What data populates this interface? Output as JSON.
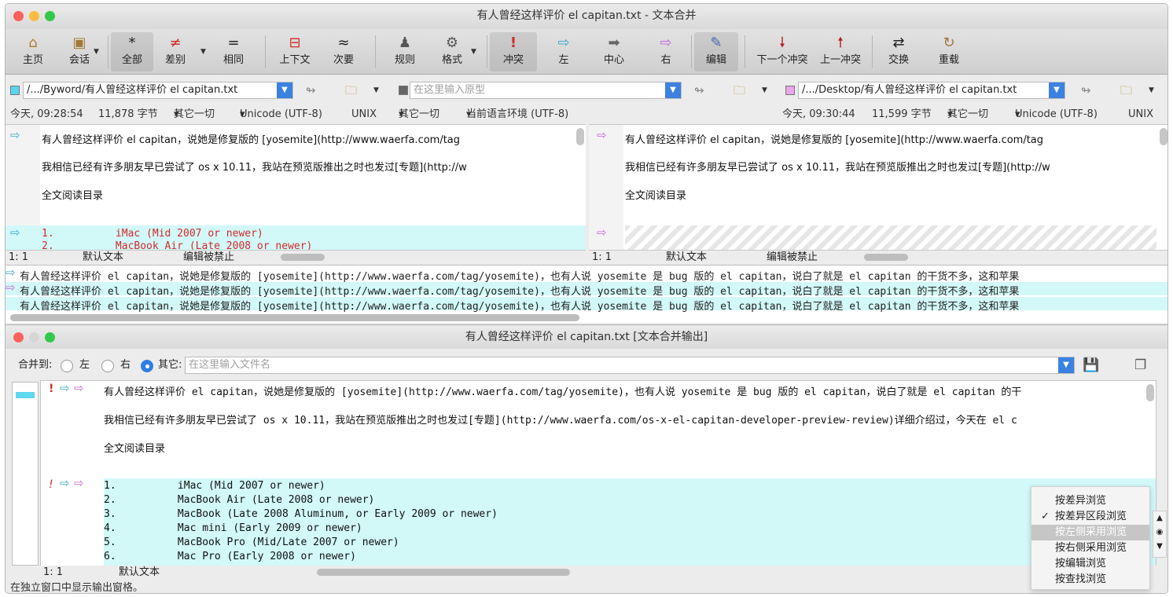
{
  "window": {
    "title": "有人曾经这样评价 el capitan.txt - 文本合并"
  },
  "toolbar": {
    "home": "主页",
    "session": "会话",
    "all": "全部",
    "diff": "差别",
    "same": "相同",
    "context": "上下文",
    "minor": "次要",
    "rules": "规则",
    "format": "格式",
    "conflict": "冲突",
    "left": "左",
    "center": "中心",
    "right": "右",
    "edit": "编辑",
    "next_conflict": "下一个冲突",
    "prev_conflict": "上一冲突",
    "swap": "交换",
    "reload": "重载"
  },
  "paths": {
    "left": "/.../Byword/有人曾经这样评价 el capitan.txt",
    "center_placeholder": "在这里输入原型",
    "right": "/.../Desktop/有人曾经这样评价 el capitan.txt"
  },
  "info": {
    "left_time": "今天, 09:28:54",
    "left_chars": "11,878 字节",
    "left_other": "其它一切",
    "left_enc": "Unicode (UTF-8)",
    "left_eol": "UNIX",
    "center_other": "其它一切",
    "center_enc": "当前语言环境 (UTF-8)",
    "right_time": "今天, 09:30:44",
    "right_chars": "11,599 字节",
    "right_other": "其它一切",
    "right_enc": "Unicode (UTF-8)",
    "right_eol": "UNIX"
  },
  "left_pane": {
    "line1": "有人曾经这样评价 el capitan，说她是修复版的 [yosemite](http://www.waerfa.com/tag",
    "line2": "我相信已经有许多朋友早已尝试了 os x 10.11，我站在预览版推出之时也发过[专题](http://w",
    "line3": "全文阅读目录",
    "line4": "1.          iMac (Mid 2007 or newer)",
    "line5": "2.          MacBook Air (Late 2008 or newer)",
    "pos": "1: 1",
    "mode": "默认文本",
    "edit": "编辑被禁止"
  },
  "right_pane": {
    "line1": "有人曾经这样评价 el capitan，说她是修复版的 [yosemite](http://www.waerfa.com/tag",
    "line2": "我相信已经有许多朋友早已尝试了 os x 10.11，我站在预览版推出之时也发过[专题](http://w",
    "line3": "全文阅读目录",
    "pos": "1: 1",
    "mode": "默认文本",
    "edit": "编辑被禁止"
  },
  "summary": {
    "line": "有人曾经这样评价 el capitan，说她是修复版的 [yosemite](http://www.waerfa.com/tag/yosemite)，也有人说 yosemite 是 bug 版的 el capitan，说白了就是 el capitan 的干货不多，这和苹果"
  },
  "output_window": {
    "title": "有人曾经这样评价 el capitan.txt [文本合并输出]",
    "merge_to": "合并到:",
    "opt_left": "左",
    "opt_right": "右",
    "opt_other": "其它:",
    "filename_placeholder": "在这里输入文件名",
    "line1": "有人曾经这样评价 el capitan，说她是修复版的 [yosemite](http://www.waerfa.com/tag/yosemite)，也有人说 yosemite 是 bug 版的 el capitan，说白了就是 el capitan 的干",
    "line2": "我相信已经有许多朋友早已尝试了 os x 10.11，我站在预览版推出之时也发过[专题](http://www.waerfa.com/os-x-el-capitan-developer-preview-review)详细介绍过，今天在 el c",
    "line3": "全文阅读目录",
    "items": [
      "1.          iMac (Mid 2007 or newer)",
      "2.          MacBook Air (Late 2008 or newer)",
      "3.          MacBook (Late 2008 Aluminum, or Early 2009 or newer)",
      "4.          Mac mini (Early 2009 or newer)",
      "5.          MacBook Pro (Mid/Late 2007 or newer)",
      "6.          Mac Pro (Early 2008 or newer)"
    ],
    "pos": "1: 1",
    "mode": "默认文本",
    "status": "在独立窗口中显示输出窗格。"
  },
  "menu": {
    "items": [
      "按差异浏览",
      "按差异区段浏览",
      "按左侧采用浏览",
      "按右侧采用浏览",
      "按编辑浏览",
      "按查找浏览"
    ],
    "checked_index": 1,
    "selected_index": 2
  },
  "colors": {
    "accent": "#3b82e0",
    "highlight": "#d2f8f8",
    "conflict": "#d42a2a"
  }
}
